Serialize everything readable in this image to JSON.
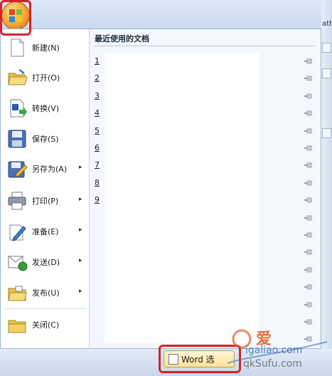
{
  "menu": {
    "items": [
      {
        "label": "新建(N)",
        "icon": "new-document-icon",
        "arrow": ""
      },
      {
        "label": "打开(O)",
        "icon": "open-folder-icon",
        "arrow": ""
      },
      {
        "label": "转换(V)",
        "icon": "convert-icon",
        "arrow": ""
      },
      {
        "label": "保存(S)",
        "icon": "save-floppy-icon",
        "arrow": ""
      },
      {
        "label": "另存为(A)",
        "icon": "save-as-icon",
        "arrow": "▸"
      },
      {
        "label": "打印(P)",
        "icon": "printer-icon",
        "arrow": "▸"
      },
      {
        "label": "准备(E)",
        "icon": "prepare-pen-icon",
        "arrow": "▸"
      },
      {
        "label": "发送(D)",
        "icon": "send-icon",
        "arrow": "▸"
      },
      {
        "label": "发布(U)",
        "icon": "publish-folder-icon",
        "arrow": "▸"
      },
      {
        "label": "关闭(C)",
        "icon": "close-folder-icon",
        "arrow": ""
      }
    ]
  },
  "recent": {
    "title": "最近使用的文档",
    "numbers": [
      "1",
      "2",
      "3",
      "4",
      "5",
      "6",
      "7",
      "8",
      "9"
    ]
  },
  "bottom": {
    "word_options_label": "Word 选"
  },
  "window": {
    "right_edge_text": "ath"
  },
  "watermark": {
    "line1": "爱",
    "line2": "igaliao.com",
    "line3": "qkSufu.com"
  },
  "colors": {
    "highlight_red": "#d8232a",
    "office_orange": "#f3a12e"
  }
}
